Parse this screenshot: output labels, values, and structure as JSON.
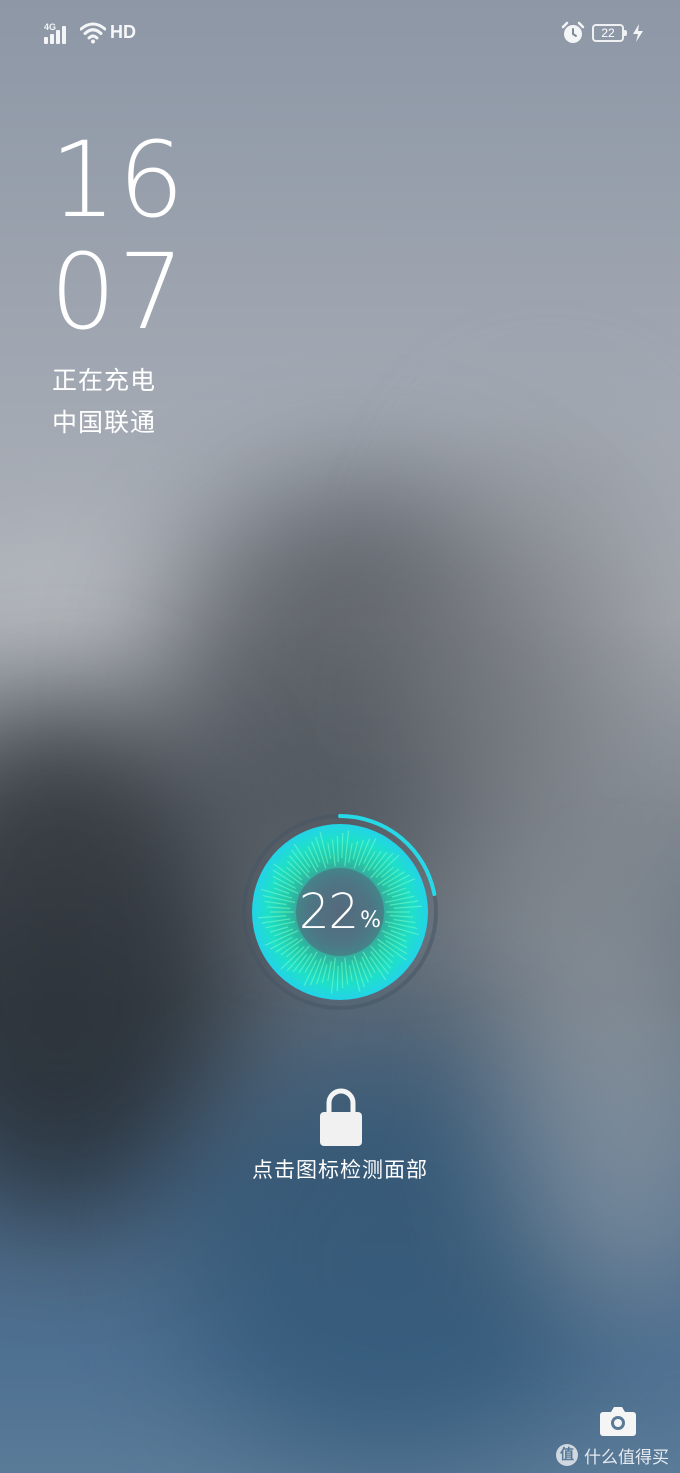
{
  "status_bar": {
    "network_type": "4G",
    "hd_label": "HD",
    "battery_level": "22",
    "signal_icon": "signal-bars-icon",
    "wifi_icon": "wifi-icon",
    "alarm_icon": "alarm-clock-icon",
    "charging_icon": "lightning-bolt-icon"
  },
  "clock": {
    "hours": "16",
    "minutes": "07"
  },
  "lock_info": {
    "charging_status": "正在充电",
    "carrier": "中国联通"
  },
  "charging": {
    "percent_value": "22",
    "percent_sign": "%",
    "progress": 0.22,
    "accent_color": "#27d8e6"
  },
  "unlock": {
    "lock_icon": "padlock-icon",
    "hint": "点击图标检测面部"
  },
  "shortcuts": {
    "camera_icon": "camera-icon"
  },
  "watermark": {
    "badge": "值",
    "text": "什么值得买"
  }
}
